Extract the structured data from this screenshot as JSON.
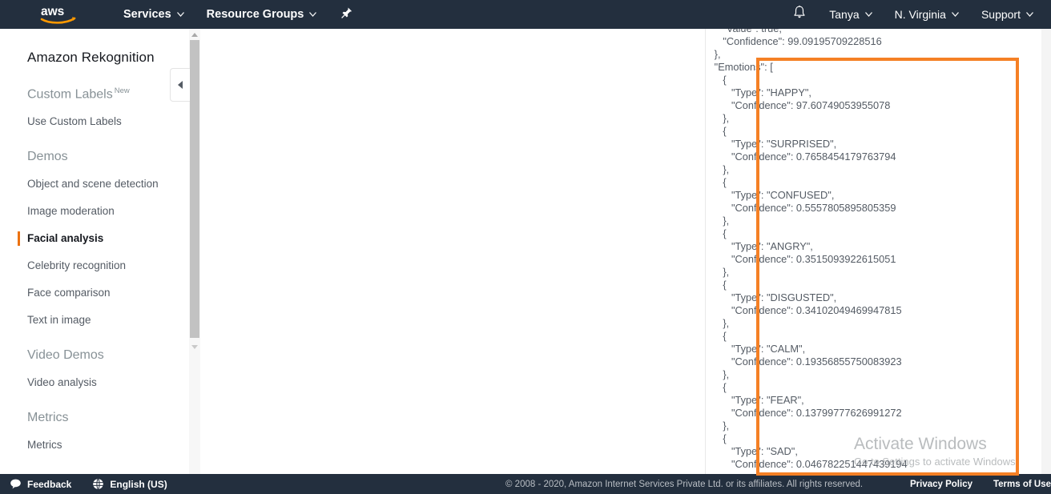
{
  "topnav": {
    "logo_alt": "aws",
    "services_label": "Services",
    "resource_groups_label": "Resource Groups",
    "caret": "⌄",
    "pin_icon": "pin-icon",
    "bell_icon": "bell-icon",
    "user_label": "Tanya",
    "region_label": "N. Virginia",
    "support_label": "Support"
  },
  "sidebar": {
    "service_title": "Amazon Rekognition",
    "groups": [
      {
        "label": "Custom Labels",
        "badge": "New",
        "items": [
          {
            "label": "Use Custom Labels",
            "active": false
          }
        ]
      },
      {
        "label": "Demos",
        "badge": "",
        "items": [
          {
            "label": "Object and scene detection",
            "active": false
          },
          {
            "label": "Image moderation",
            "active": false
          },
          {
            "label": "Facial analysis",
            "active": true
          },
          {
            "label": "Celebrity recognition",
            "active": false
          },
          {
            "label": "Face comparison",
            "active": false
          },
          {
            "label": "Text in image",
            "active": false
          }
        ]
      },
      {
        "label": "Video Demos",
        "badge": "",
        "items": [
          {
            "label": "Video analysis",
            "active": false
          }
        ]
      },
      {
        "label": "Metrics",
        "badge": "",
        "items": [
          {
            "label": "Metrics",
            "active": false
          }
        ]
      }
    ],
    "collapse_icon": "chevron-left-icon"
  },
  "json_panel": {
    "accent_color": "#f58025",
    "text": "      \"Value\": true,\n      \"Confidence\": 99.09195709228516\n   },\n   \"Emotions\": [\n      {\n         \"Type\": \"HAPPY\",\n         \"Confidence\": 97.60749053955078\n      },\n      {\n         \"Type\": \"SURPRISED\",\n         \"Confidence\": 0.7658454179763794\n      },\n      {\n         \"Type\": \"CONFUSED\",\n         \"Confidence\": 0.5557805895805359\n      },\n      {\n         \"Type\": \"ANGRY\",\n         \"Confidence\": 0.3515093922615051\n      },\n      {\n         \"Type\": \"DISGUSTED\",\n         \"Confidence\": 0.34102049469947815\n      },\n      {\n         \"Type\": \"CALM\",\n         \"Confidence\": 0.19356855750083923\n      },\n      {\n         \"Type\": \"FEAR\",\n         \"Confidence\": 0.13799777626991272\n      },\n      {\n         \"Type\": \"SAD\",\n         \"Confidence\": 0.046782251447439194",
    "emotions": [
      {
        "type": "HAPPY",
        "confidence": "97.60749053955078"
      },
      {
        "type": "SURPRISED",
        "confidence": "0.7658454179763794"
      },
      {
        "type": "CONFUSED",
        "confidence": "0.5557805895805359"
      },
      {
        "type": "ANGRY",
        "confidence": "0.3515093922615051"
      },
      {
        "type": "DISGUSTED",
        "confidence": "0.34102049469947815"
      },
      {
        "type": "CALM",
        "confidence": "0.19356855750083923"
      },
      {
        "type": "FEAR",
        "confidence": "0.13799777626991272"
      },
      {
        "type": "SAD",
        "confidence": "0.046782251447439194"
      }
    ],
    "preceding_fragment": {
      "value_key": "\"Value\": true,",
      "confidence": "99.09195709228516"
    }
  },
  "watermark": {
    "line1": "Activate Windows",
    "line2": "Go to Settings to activate Windows."
  },
  "footer": {
    "feedback_label": "Feedback",
    "language_label": "English (US)",
    "copyright": "© 2008 - 2020, Amazon Internet Services Private Ltd. or its affiliates. All rights reserved.",
    "privacy_label": "Privacy Policy",
    "terms_label": "Terms of Use"
  }
}
